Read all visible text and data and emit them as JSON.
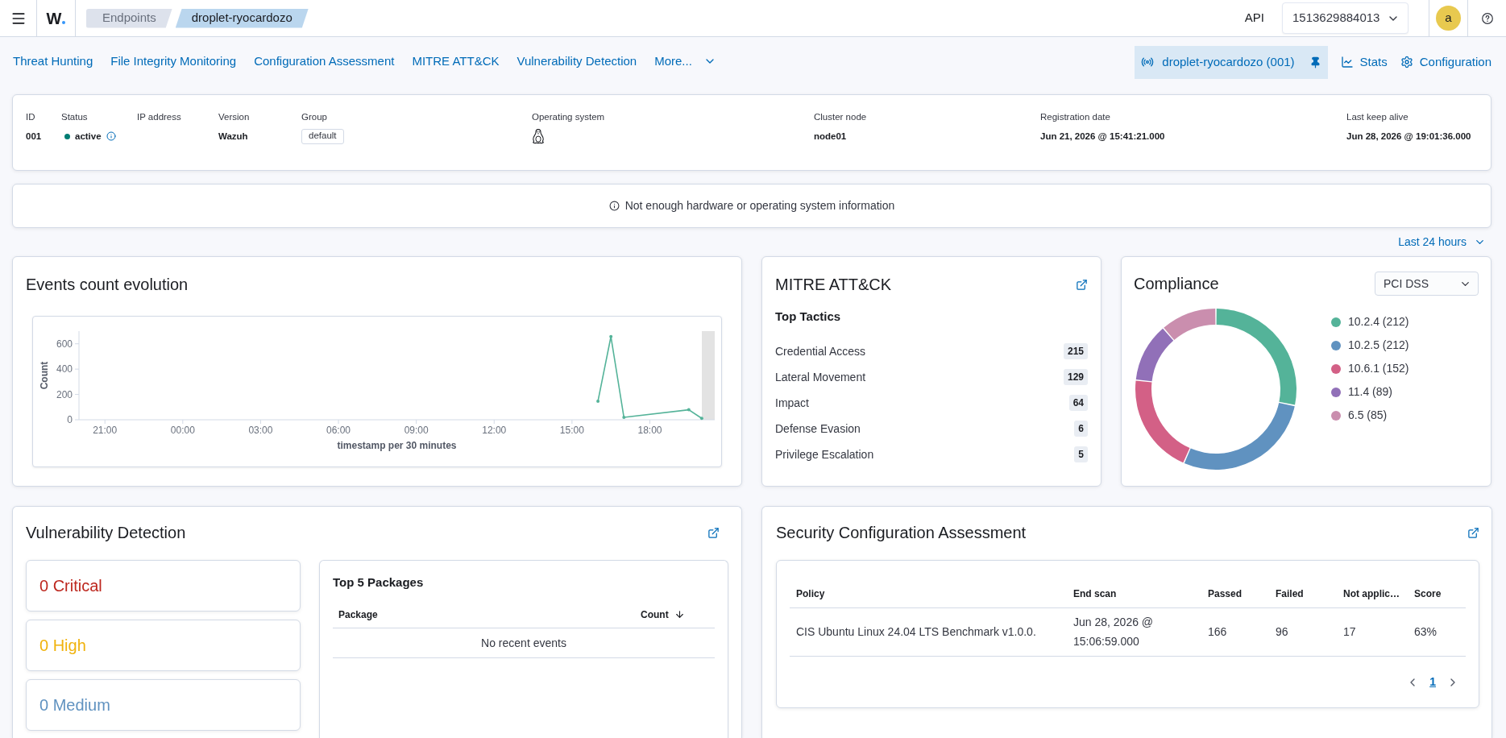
{
  "header": {
    "logo": "W",
    "breadcrumbs": [
      {
        "label": "Endpoints",
        "selected": false
      },
      {
        "label": "droplet-ryocardozo",
        "selected": true
      }
    ],
    "api_label": "API",
    "api_selector": {
      "value": "1513629884013"
    },
    "avatar": "a"
  },
  "nav": {
    "tabs": [
      {
        "label": "Threat Hunting",
        "kind": "link",
        "selected": false
      },
      {
        "label": "File Integrity Monitoring",
        "kind": "link",
        "selected": false
      },
      {
        "label": "Configuration Assessment",
        "kind": "link",
        "selected": false
      },
      {
        "label": "MITRE ATT&CK",
        "kind": "link",
        "selected": false
      },
      {
        "label": "Vulnerability Detection",
        "kind": "link",
        "selected": false
      },
      {
        "label": "More...",
        "kind": "menu",
        "selected": false
      }
    ],
    "agent": {
      "label": "droplet-ryocardozo (001)",
      "pinned": true
    },
    "actions": [
      {
        "label": "Stats",
        "kind": "stats"
      },
      {
        "label": "Configuration",
        "kind": "settings"
      }
    ]
  },
  "agent_info": {
    "fields": [
      {
        "label": "ID",
        "kind": "text",
        "value": "001"
      },
      {
        "label": "Status",
        "kind": "status",
        "value": "active"
      },
      {
        "label": "IP address",
        "kind": "text"
      },
      {
        "label": "Version",
        "kind": "text",
        "value": "Wazuh"
      },
      {
        "label": "Group",
        "kind": "badge",
        "value": "default"
      },
      {
        "label": "Operating system",
        "kind": "os"
      },
      {
        "label": "Cluster node",
        "kind": "text",
        "value": "node01"
      },
      {
        "label": "Registration date",
        "kind": "text",
        "value": "Jun 21, 2026 @ 15:41:21.000"
      },
      {
        "label": "Last keep alive",
        "kind": "text",
        "value": "Jun 28, 2026 @ 19:01:36.000"
      }
    ]
  },
  "notice": {
    "text": "Not enough hardware or operating system information"
  },
  "time_range": {
    "label": "Last 24 hours"
  },
  "events": {
    "title": "Events count evolution",
    "chart_data": {
      "type": "line",
      "xlabel": "timestamp per 30 minutes",
      "ylabel": "Count",
      "categories": [
        null,
        null,
        "21:00",
        null,
        null,
        null,
        null,
        null,
        "00:00",
        null,
        null,
        null,
        null,
        null,
        "03:00",
        null,
        null,
        null,
        null,
        null,
        "06:00",
        null,
        null,
        null,
        null,
        null,
        "09:00",
        null,
        null,
        null,
        null,
        null,
        "12:00",
        null,
        null,
        null,
        null,
        null,
        "15:00",
        null,
        null,
        null,
        null,
        null,
        "18:00",
        null,
        null,
        null,
        null
      ],
      "series": [
        {
          "color": "#54b399",
          "values": [
            null,
            null,
            null,
            null,
            null,
            null,
            null,
            null,
            null,
            null,
            null,
            null,
            null,
            null,
            null,
            null,
            null,
            null,
            null,
            null,
            null,
            null,
            null,
            null,
            null,
            null,
            null,
            null,
            null,
            null,
            null,
            null,
            null,
            null,
            null,
            null,
            null,
            null,
            null,
            null,
            147,
            657,
            19,
            null,
            null,
            null,
            null,
            79,
            11
          ]
        }
      ],
      "ylim": [
        0,
        700
      ],
      "yticks": [
        0,
        200,
        400,
        600
      ]
    }
  },
  "mitre": {
    "title": "MITRE ATT&CK",
    "subtitle": "Top Tactics",
    "tactics": [
      {
        "name": "Credential Access",
        "count": "215"
      },
      {
        "name": "Lateral Movement",
        "count": "129"
      },
      {
        "name": "Impact",
        "count": "64"
      },
      {
        "name": "Defense Evasion",
        "count": "6"
      },
      {
        "name": "Privilege Escalation",
        "count": "5"
      }
    ]
  },
  "compliance": {
    "title": "Compliance",
    "standard": "PCI DSS",
    "chart_data": {
      "type": "donut",
      "categories": [
        "10.2.4 (212)",
        "10.2.5 (212)",
        "10.6.1 (152)",
        "11.4 (89)",
        "6.5 (85)"
      ],
      "values": [
        212,
        212,
        152,
        89,
        85
      ]
    },
    "legend": [
      {
        "color": "#54b399"
      },
      {
        "color": "#6092c0"
      },
      {
        "color": "#d36086"
      },
      {
        "color": "#9170b8"
      },
      {
        "color": "#ca8eae"
      }
    ]
  },
  "vulnerability": {
    "title": "Vulnerability Detection",
    "severities": [
      {
        "label": "0 Critical",
        "color": "#bd271e"
      },
      {
        "label": "0 High",
        "color": "#f0b20c"
      },
      {
        "label": "0 Medium",
        "color": "#6092c0"
      }
    ],
    "top_packages": {
      "title": "Top 5 Packages",
      "columns": [
        {
          "label": "Package",
          "sorted": false
        },
        {
          "label": "Count",
          "sorted": true
        }
      ],
      "empty_text": "No recent events"
    }
  },
  "sca": {
    "title": "Security Configuration Assessment",
    "columns": [
      "Policy",
      "End scan",
      "Passed",
      "Failed",
      "Not applic…",
      "Score"
    ],
    "rows": [
      [
        "CIS Ubuntu Linux 24.04 LTS Benchmark v1.0.0.",
        "Jun 28, 2026 @ 15:06:59.000",
        "166",
        "96",
        "17",
        "63%"
      ]
    ],
    "pages": [
      {
        "label": "1",
        "selected": true
      }
    ]
  }
}
